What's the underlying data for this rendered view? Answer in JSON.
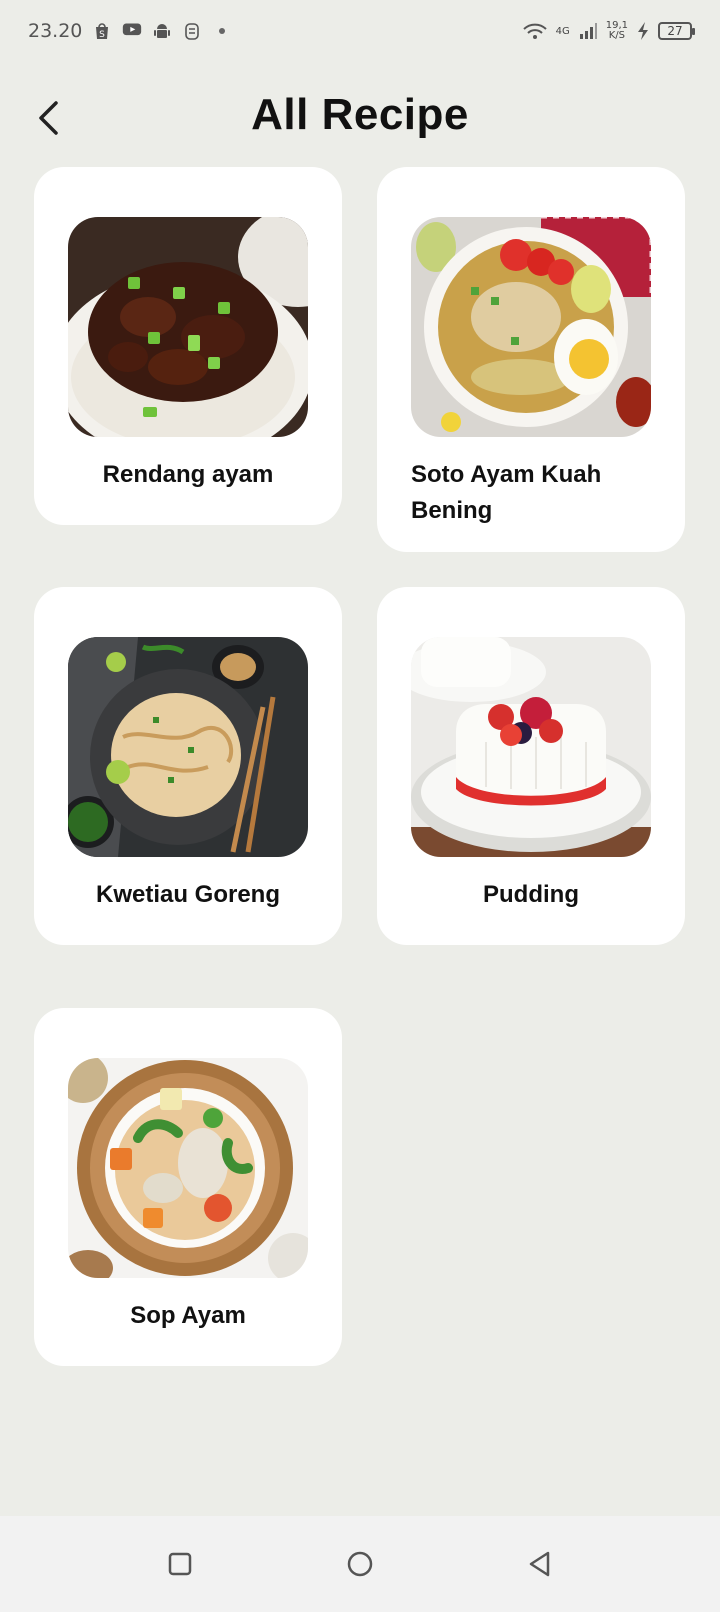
{
  "status_bar": {
    "time": "23.20",
    "network_type": "4G",
    "net_speed_value": "19,1",
    "net_speed_unit": "K/S",
    "battery": "27"
  },
  "header": {
    "title": "All Recipe"
  },
  "recipes": [
    {
      "name": "Rendang ayam"
    },
    {
      "name": "Soto Ayam Kuah Bening"
    },
    {
      "name": "Kwetiau Goreng"
    },
    {
      "name": "Pudding"
    },
    {
      "name": "Sop Ayam"
    }
  ]
}
